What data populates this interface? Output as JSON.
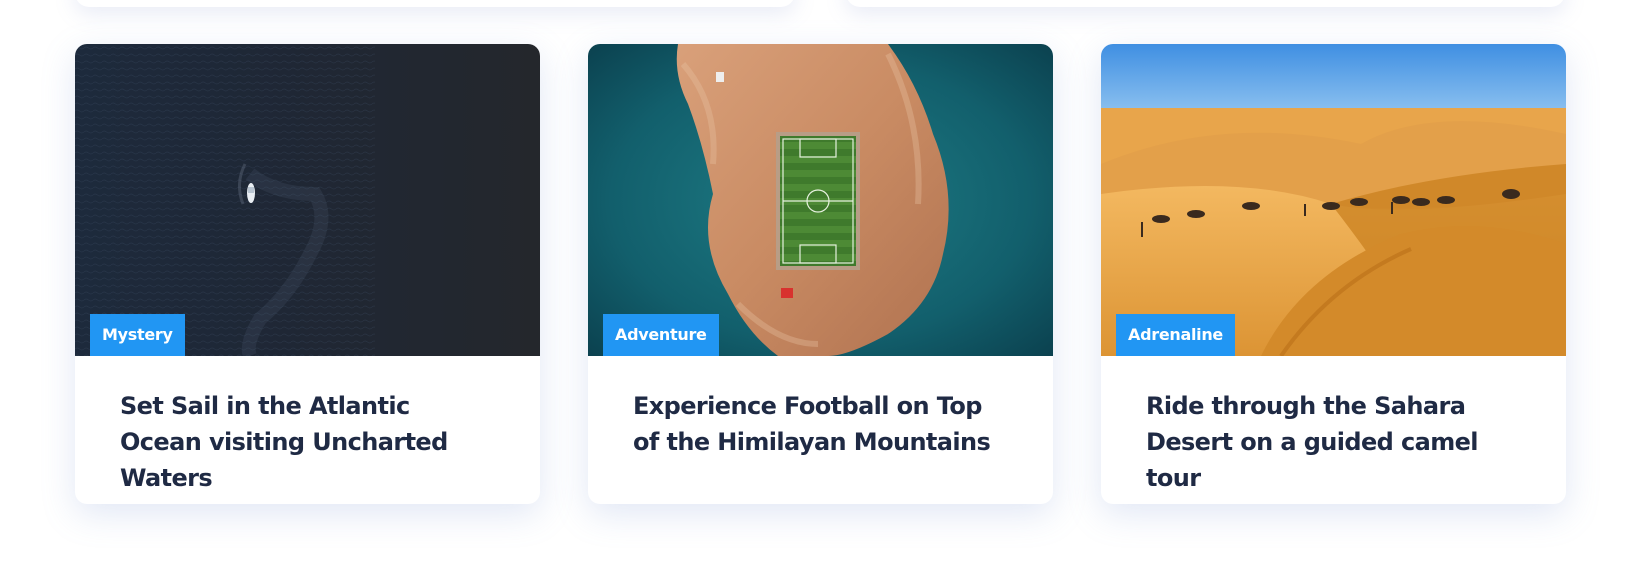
{
  "cards": [
    {
      "tag": "Mystery",
      "title": "Set Sail in the Atlantic Ocean visiting Uncharted Waters",
      "image": "aerial-ocean-boat"
    },
    {
      "tag": "Adventure",
      "title": "Experience Football on Top of the Himilayan Mountains",
      "image": "aerial-island-football-pitch"
    },
    {
      "tag": "Adrenaline",
      "title": "Ride through the Sahara Desert on a guided camel tour",
      "image": "desert-camel-caravan"
    }
  ],
  "colors": {
    "tag_background": "#2196f3",
    "title_text": "#1f2a44",
    "card_background": "#ffffff"
  }
}
